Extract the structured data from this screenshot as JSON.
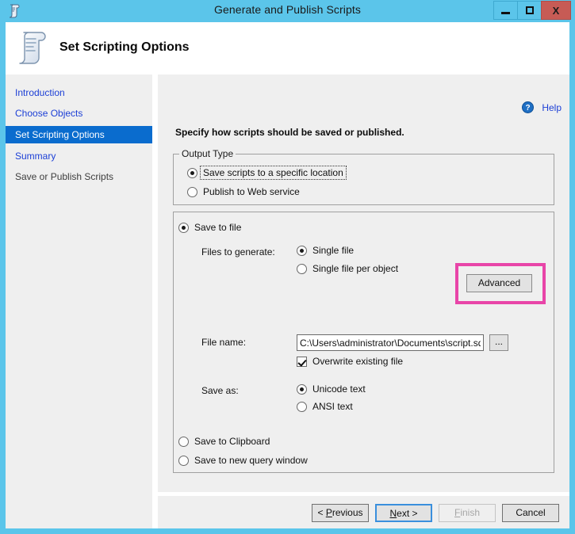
{
  "window": {
    "title": "Generate and Publish Scripts",
    "icon": "script-scroll-icon",
    "controls": {
      "minimize": "minimize-icon",
      "maximize": "maximize-icon",
      "close": "X"
    }
  },
  "banner": {
    "icon": "script-scroll-icon",
    "title": "Set Scripting Options"
  },
  "sidebar": {
    "items": [
      {
        "label": "Introduction",
        "state": "link"
      },
      {
        "label": "Choose Objects",
        "state": "link"
      },
      {
        "label": "Set Scripting Options",
        "state": "active"
      },
      {
        "label": "Summary",
        "state": "link"
      },
      {
        "label": "Save or Publish Scripts",
        "state": "plain"
      }
    ]
  },
  "main": {
    "help": {
      "label": "Help",
      "icon": "help-question-icon"
    },
    "instruction": "Specify how scripts should be saved or published.",
    "output_type": {
      "legend": "Output Type",
      "options": [
        {
          "label": "Save scripts to a specific location",
          "checked": true,
          "focused": true
        },
        {
          "label": "Publish to Web service",
          "checked": false,
          "focused": false
        }
      ]
    },
    "save_group": {
      "save_to_file": {
        "label": "Save to file",
        "checked": true
      },
      "advanced_button": "Advanced",
      "files_to_generate": {
        "label": "Files to generate:",
        "options": [
          {
            "label": "Single file",
            "checked": true
          },
          {
            "label": "Single file per object",
            "checked": false
          }
        ]
      },
      "file_name": {
        "label": "File name:",
        "value": "C:\\Users\\administrator\\Documents\\script.sql",
        "browse_button": "..."
      },
      "overwrite": {
        "label": "Overwrite existing file",
        "checked": true
      },
      "save_as": {
        "label": "Save as:",
        "options": [
          {
            "label": "Unicode text",
            "checked": true
          },
          {
            "label": "ANSI text",
            "checked": false
          }
        ]
      },
      "save_to_clipboard": {
        "label": "Save to Clipboard",
        "checked": false
      },
      "save_to_new_query_window": {
        "label": "Save to new query window",
        "checked": false
      }
    }
  },
  "footer": {
    "buttons": [
      {
        "pre": "< ",
        "acc": "P",
        "post": "revious",
        "state": "normal"
      },
      {
        "pre": "",
        "acc": "N",
        "post": "ext >",
        "state": "default"
      },
      {
        "pre": "",
        "acc": "F",
        "post": "inish",
        "state": "disabled"
      },
      {
        "pre": "Cancel",
        "acc": "",
        "post": "",
        "state": "normal"
      }
    ]
  },
  "colors": {
    "titlebar": "#5bc5ea",
    "accent_selected": "#0a6cce",
    "link": "#1c3fd6",
    "highlight_box": "#e845a8",
    "panel": "#efefef",
    "close_button": "#c75b55"
  }
}
